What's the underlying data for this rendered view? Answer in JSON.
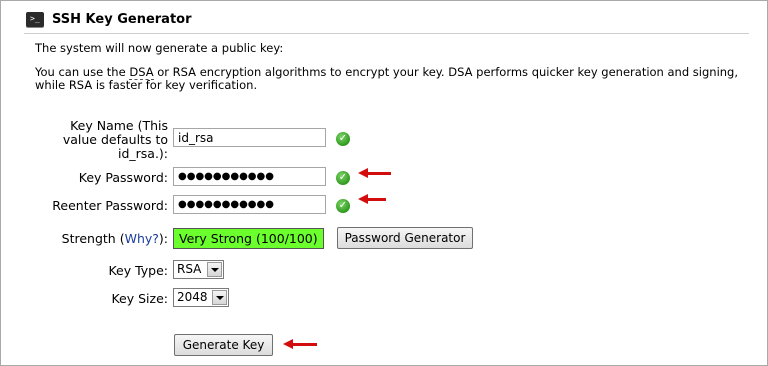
{
  "header": {
    "title": "SSH Key Generator",
    "icon": "terminal-icon",
    "icon_glyph": ">_"
  },
  "intro": "The system will now generate a public key:",
  "description": {
    "before": "You can use the ",
    "dsa": "DSA",
    "after": " or RSA encryption algorithms to encrypt your key. DSA performs quicker key generation and signing, while RSA is faster for key verification."
  },
  "form": {
    "key_name_label": "Key Name (This value defaults to id_rsa.):",
    "key_name_value": "id_rsa",
    "key_password_label": "Key Password:",
    "key_password_value": "●●●●●●●●●●●",
    "reenter_password_label": "Reenter Password:",
    "reenter_password_value": "●●●●●●●●●●●",
    "strength_label": "Strength",
    "strength_why": "Why?",
    "strength_value": "Very Strong (100/100)",
    "strength_color": "#6cff2e",
    "password_generator_button": "Password Generator",
    "key_type_label": "Key Type:",
    "key_type_value": "RSA",
    "key_size_label": "Key Size:",
    "key_size_value": "2048",
    "generate_button": "Generate Key"
  },
  "colors": {
    "valid_check": "#2f9a1e",
    "arrow": "#d30d0d"
  }
}
